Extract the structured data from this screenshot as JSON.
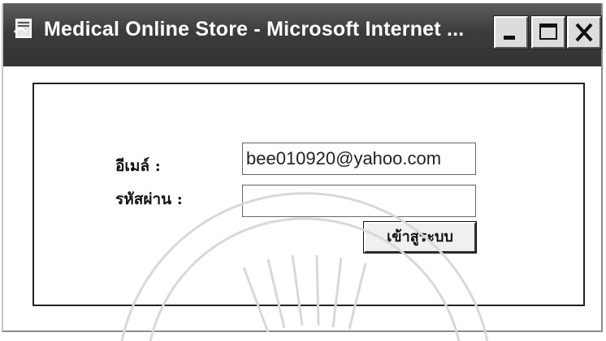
{
  "window": {
    "title": "Medical Online Store - Microsoft Internet ...",
    "controls": {
      "minimize": "minimize",
      "maximize": "maximize",
      "close": "close"
    }
  },
  "login_form": {
    "email_label": "อีเมล์ :",
    "email_value": "bee010920@yahoo.com",
    "password_label": "รหัสผ่าน :",
    "password_value": "",
    "submit_label": "เข้าสู่ระบบ"
  },
  "colors": {
    "titlebar": "#3c3c3c",
    "title_text": "#ffffff",
    "button_face": "#dcdcdc",
    "frame_border": "#222222"
  },
  "icons": [
    "ie-window-icon",
    "minimize-icon",
    "maximize-icon",
    "close-icon"
  ]
}
